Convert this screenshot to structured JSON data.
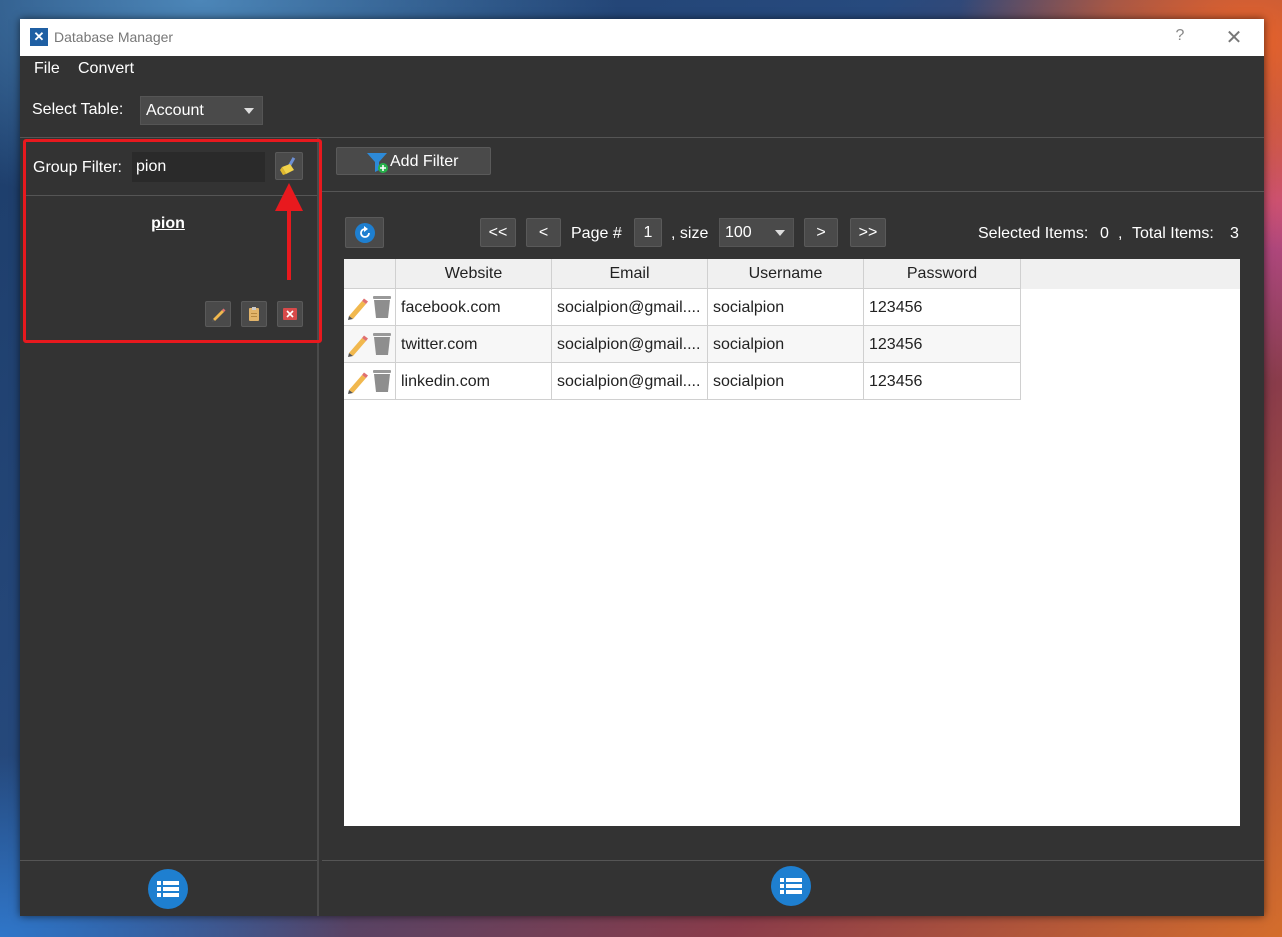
{
  "window": {
    "title": "Database Manager",
    "help": "?",
    "close": "✕"
  },
  "menu": {
    "file": "File",
    "convert": "Convert"
  },
  "table_select": {
    "label": "Select Table:",
    "value": "Account"
  },
  "group_filter": {
    "label": "Group Filter:",
    "value": "pion",
    "group_name": "pion"
  },
  "toolbar": {
    "add_filter": "Add Filter"
  },
  "pagination": {
    "first": "<<",
    "prev": "<",
    "page_label": "Page #",
    "page": "1",
    "size_label": ", size",
    "size": "100",
    "next": ">",
    "last": ">>",
    "selected_label": "Selected Items:",
    "selected": "0",
    "sep": ",",
    "total_label": "Total Items:",
    "total": "3"
  },
  "table": {
    "columns": [
      "Website",
      "Email",
      "Username",
      "Password"
    ],
    "rows": [
      [
        "facebook.com",
        "socialpion@gmail....",
        "socialpion",
        "123456"
      ],
      [
        "twitter.com",
        "socialpion@gmail....",
        "socialpion",
        "123456"
      ],
      [
        "linkedin.com",
        "socialpion@gmail....",
        "socialpion",
        "123456"
      ]
    ]
  },
  "colors": {
    "accent": "#1e7fd0",
    "highlight": "#e8191e",
    "background": "#333333"
  }
}
